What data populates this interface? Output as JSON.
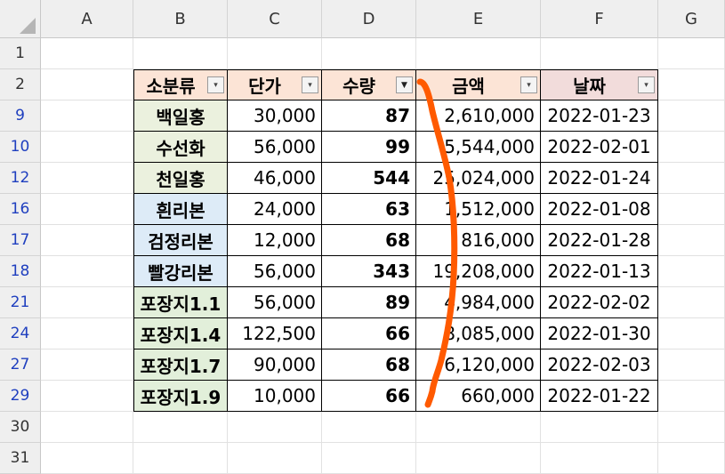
{
  "columns": [
    "A",
    "B",
    "C",
    "D",
    "E",
    "F",
    "G"
  ],
  "rows": [
    "1",
    "2",
    "9",
    "10",
    "12",
    "16",
    "17",
    "18",
    "21",
    "24",
    "27",
    "29",
    "30",
    "31"
  ],
  "headers": [
    "소분류",
    "단가",
    "수량",
    "금액",
    "날짜"
  ],
  "table": [
    [
      "백일홍",
      "30,000",
      "87",
      "2,610,000",
      "2022-01-23"
    ],
    [
      "수선화",
      "56,000",
      "99",
      "5,544,000",
      "2022-02-01"
    ],
    [
      "천일홍",
      "46,000",
      "544",
      "25,024,000",
      "2022-01-24"
    ],
    [
      "흰리본",
      "24,000",
      "63",
      "1,512,000",
      "2022-01-08"
    ],
    [
      "검정리본",
      "12,000",
      "68",
      "816,000",
      "2022-01-28"
    ],
    [
      "빨강리본",
      "56,000",
      "343",
      "19,208,000",
      "2022-01-13"
    ],
    [
      "포장지1.1",
      "56,000",
      "89",
      "4,984,000",
      "2022-02-02"
    ],
    [
      "포장지1.4",
      "122,500",
      "66",
      "8,085,000",
      "2022-01-30"
    ],
    [
      "포장지1.7",
      "90,000",
      "68",
      "6,120,000",
      "2022-02-03"
    ],
    [
      "포장지1.9",
      "10,000",
      "66",
      "660,000",
      "2022-01-22"
    ]
  ],
  "colors": {
    "header_peach": "#fce4d6",
    "header_pink": "#f2dcdb",
    "flower_bg": "#ebf1de",
    "ribbon_bg": "#ddebf7",
    "paper_bg": "#e2efda",
    "annotation_stroke": "#ff5a00"
  },
  "icons": {
    "filter_dropdown": "dropdown-arrow-icon",
    "filter_active": "filter-applied-icon"
  }
}
